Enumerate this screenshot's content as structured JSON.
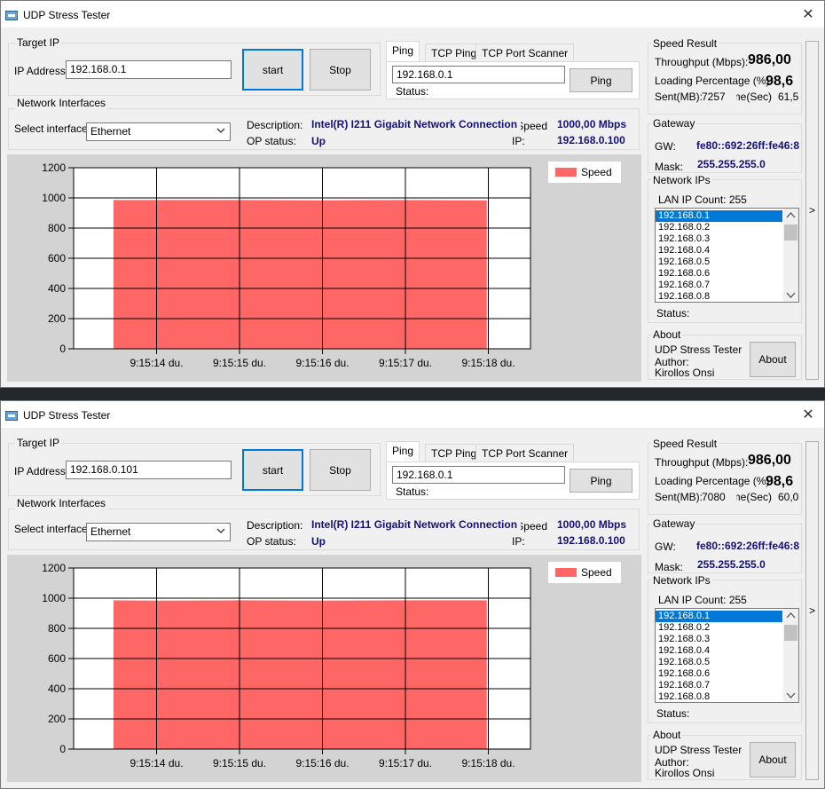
{
  "colors": {
    "bar": "#ff6666",
    "selection": "#0078d7",
    "navy_text": "#14107a"
  },
  "windows": [
    {
      "title": "UDP Stress Tester",
      "target_ip": {
        "group": "Target IP",
        "ip_label": "IP Address",
        "ip_value": "192.168.0.1",
        "start_label": "start",
        "stop_label": "Stop"
      },
      "ping": {
        "tabs": [
          "Ping",
          "TCP Ping",
          "TCP Port Scanner"
        ],
        "ip_value": "192.168.0.1",
        "ping_button": "Ping",
        "status_label": "Status:"
      },
      "network_interfaces": {
        "group": "Network Interfaces",
        "select_label": "Select interface",
        "selected": "Ethernet",
        "description_label": "Description:",
        "description_value": "Intel(R) I211 Gigabit Network Connection",
        "op_status_label": "OP status:",
        "op_status_value": "Up",
        "speed_label": "Speed:",
        "speed_value": "1000,00 Mbps",
        "ip_label": "IP:",
        "ip_value": "192.168.0.100"
      },
      "speed_result": {
        "group": "Speed Result",
        "throughput_label": "Throughput (Mbps):",
        "throughput_value": "986,00",
        "loading_label": "Loading Percentage (%):",
        "loading_value": "98,6",
        "sent_label": "Sent(MB):",
        "sent_value": "7257",
        "time_label": "Time(Sec):",
        "time_value": "61,5"
      },
      "gateway": {
        "group": "Gateway",
        "gw_label": "GW:",
        "gw_value": "fe80::692:26ff:fe46:8",
        "mask_label": "Mask:",
        "mask_value": "255.255.255.0"
      },
      "network_ips": {
        "group": "Network IPs",
        "count_label": "LAN IP Count: 255",
        "items": [
          "192.168.0.1",
          "192.168.0.2",
          "192.168.0.3",
          "192.168.0.4",
          "192.168.0.5",
          "192.168.0.6",
          "192.168.0.7",
          "192.168.0.8"
        ],
        "status_label": "Status:"
      },
      "about": {
        "group": "About",
        "app_name": "UDP Stress Tester",
        "author_label": "Author:",
        "author_name": "Kirollos Onsi",
        "button": "About"
      },
      "expand_glyph": ">"
    },
    {
      "title": "UDP Stress Tester",
      "target_ip": {
        "group": "Target IP",
        "ip_label": "IP Address",
        "ip_value": "192.168.0.101",
        "start_label": "start",
        "stop_label": "Stop"
      },
      "ping": {
        "tabs": [
          "Ping",
          "TCP Ping",
          "TCP Port Scanner"
        ],
        "ip_value": "192.168.0.1",
        "ping_button": "Ping",
        "status_label": "Status:"
      },
      "network_interfaces": {
        "group": "Network Interfaces",
        "select_label": "Select interface",
        "selected": "Ethernet",
        "description_label": "Description:",
        "description_value": "Intel(R) I211 Gigabit Network Connection",
        "op_status_label": "OP status:",
        "op_status_value": "Up",
        "speed_label": "Speed:",
        "speed_value": "1000,00 Mbps",
        "ip_label": "IP:",
        "ip_value": "192.168.0.100"
      },
      "speed_result": {
        "group": "Speed Result",
        "throughput_label": "Throughput (Mbps):",
        "throughput_value": "986,00",
        "loading_label": "Loading Percentage (%):",
        "loading_value": "98,6",
        "sent_label": "Sent(MB):",
        "sent_value": "7080",
        "time_label": "Time(Sec):",
        "time_value": "60,0"
      },
      "gateway": {
        "group": "Gateway",
        "gw_label": "GW:",
        "gw_value": "fe80::692:26ff:fe46:8",
        "mask_label": "Mask:",
        "mask_value": "255.255.255.0"
      },
      "network_ips": {
        "group": "Network IPs",
        "count_label": "LAN IP Count: 255",
        "items": [
          "192.168.0.1",
          "192.168.0.2",
          "192.168.0.3",
          "192.168.0.4",
          "192.168.0.5",
          "192.168.0.6",
          "192.168.0.7",
          "192.168.0.8"
        ],
        "status_label": "Status:"
      },
      "about": {
        "group": "About",
        "app_name": "UDP Stress Tester",
        "author_label": "Author:",
        "author_name": "Kirollos Onsi",
        "button": "About"
      },
      "expand_glyph": ">"
    }
  ],
  "chart_data": [
    {
      "type": "area",
      "x": [
        "9:15:13.5 du.",
        "9:15:14 du.",
        "9:15:15 du.",
        "9:15:16 du.",
        "9:15:17 du.",
        "9:15:18 du."
      ],
      "series": [
        {
          "name": "Speed",
          "values": [
            986,
            986,
            986,
            984,
            986,
            984
          ]
        }
      ],
      "x_tick_labels": [
        "9:15:14 du.",
        "9:15:15 du.",
        "9:15:16 du.",
        "9:15:17 du.",
        "9:15:18 du."
      ],
      "y_ticks": [
        0,
        200,
        400,
        600,
        800,
        1000,
        1200
      ],
      "ylim": [
        0,
        1200
      ],
      "grid": true,
      "legend": "top-right"
    },
    {
      "type": "area",
      "x": [
        "9:15:13.5 du.",
        "9:15:14 du.",
        "9:15:15 du.",
        "9:15:16 du.",
        "9:15:17 du.",
        "9:15:18 du."
      ],
      "series": [
        {
          "name": "Speed",
          "values": [
            986,
            984,
            986,
            984,
            986,
            986
          ]
        }
      ],
      "x_tick_labels": [
        "9:15:14 du.",
        "9:15:15 du.",
        "9:15:16 du.",
        "9:15:17 du.",
        "9:15:18 du."
      ],
      "y_ticks": [
        0,
        200,
        400,
        600,
        800,
        1000,
        1200
      ],
      "ylim": [
        0,
        1200
      ],
      "grid": true,
      "legend": "top-right"
    }
  ]
}
